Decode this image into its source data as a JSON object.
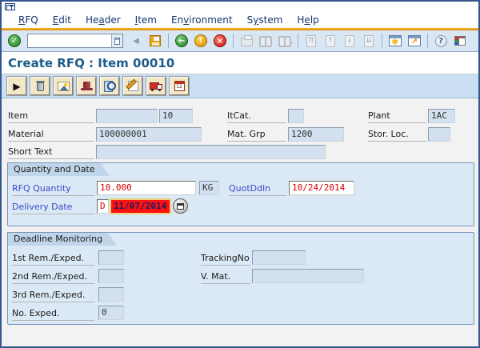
{
  "menu": {
    "items": [
      {
        "pre": "",
        "u": "R",
        "post": "FQ"
      },
      {
        "pre": "",
        "u": "E",
        "post": "dit"
      },
      {
        "pre": "He",
        "u": "a",
        "post": "der"
      },
      {
        "pre": "",
        "u": "I",
        "post": "tem"
      },
      {
        "pre": "En",
        "u": "v",
        "post": "ironment"
      },
      {
        "pre": "S",
        "u": "y",
        "post": "stem"
      },
      {
        "pre": "H",
        "u": "e",
        "post": "lp"
      }
    ]
  },
  "toolbar": {
    "command_value": ""
  },
  "icons": {
    "enter": "✓",
    "collapse": "◀",
    "back": "←",
    "exit": "↑",
    "cancel": "×",
    "find_plus": "+",
    "page_first": "⇈",
    "page_prev": "↑",
    "page_next": "↓",
    "page_last": "⇊",
    "new_session_star": "∗",
    "shortcut_arrow": "↗",
    "help": "?",
    "next_item": "▶",
    "calendar_text": "12"
  },
  "title_bar": {
    "title": "Create RFQ : Item 00010"
  },
  "form": {
    "item_label": "Item",
    "item_value": "",
    "item_number": "10",
    "itcat_label": "ItCat.",
    "itcat_value": "",
    "plant_label": "Plant",
    "plant_value": "1AC",
    "material_label": "Material",
    "material_value": "100000001",
    "matgrp_label": "Mat. Grp",
    "matgrp_value": "1200",
    "storloc_label": "Stor. Loc.",
    "storloc_value": "",
    "shorttext_label": "Short Text",
    "shorttext_value": ""
  },
  "quantity_and_date": {
    "title": "Quantity and Date",
    "rfq_qty_label": "RFQ Quantity",
    "rfq_qty_value": "10.000",
    "rfq_qty_unit": "KG",
    "quotddln_label": "QuotDdln",
    "quotddln_value": "10/24/2014",
    "delivery_label": "Delivery Date",
    "delivery_category": "D",
    "delivery_value": "11/07/2014"
  },
  "deadline_monitoring": {
    "title": "Deadline Monitoring",
    "rem1_label": "1st Rem./Exped.",
    "rem1_value": "",
    "rem2_label": "2nd Rem./Exped.",
    "rem2_value": "",
    "rem3_label": "3rd Rem./Exped.",
    "rem3_value": "",
    "noexped_label": "No. Exped.",
    "noexped_value": "0",
    "tracking_label": "TrackingNo",
    "tracking_value": "",
    "vmat_label": "V. Mat.",
    "vmat_value": ""
  },
  "colors": {
    "accent_orange": "#e89b00",
    "toolbar_blue": "#d9e6f3",
    "groupbox_blue": "#dbe8f5",
    "error_red": "#ff1010",
    "value_red": "#d40000",
    "label_blue": "#3949c8",
    "title_blue": "#1d5c8a"
  }
}
